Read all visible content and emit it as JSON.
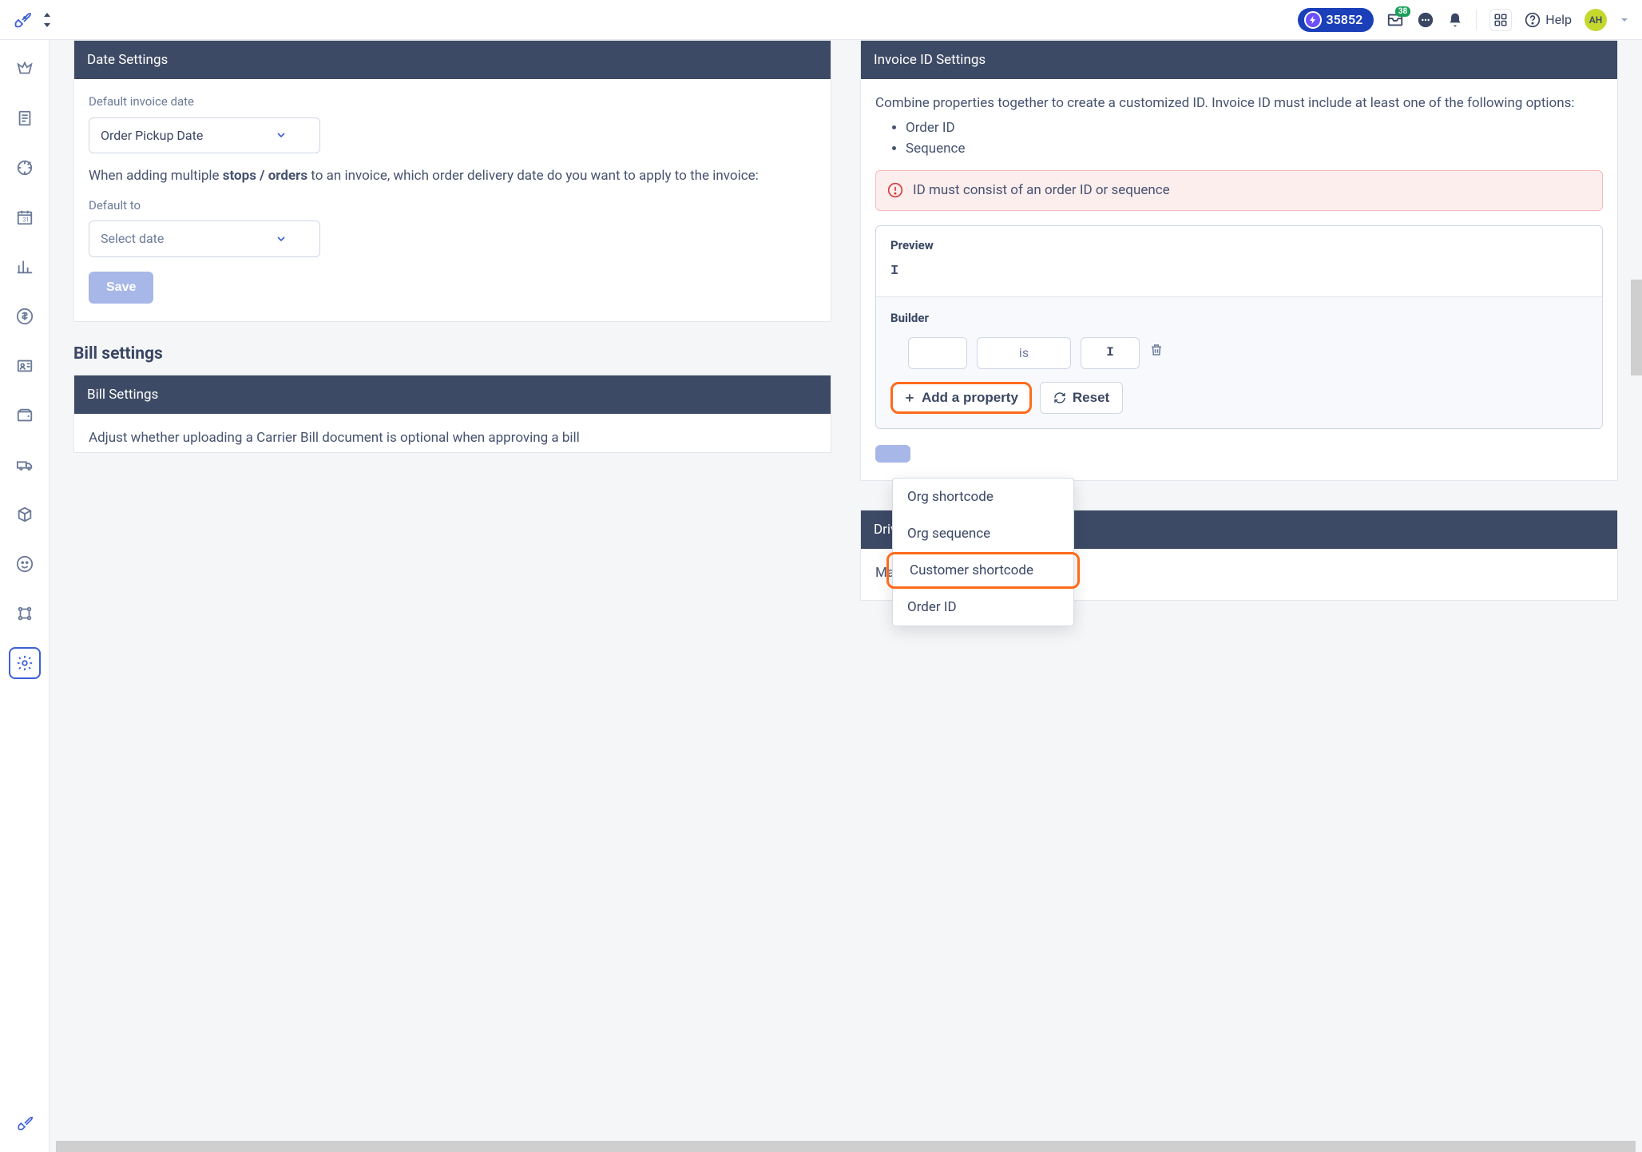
{
  "topbar": {
    "points": "35852",
    "notif_badge": "38",
    "help": "Help",
    "avatar": "AH"
  },
  "date_settings": {
    "header": "Date Settings",
    "default_label": "Default invoice date",
    "default_value": "Order Pickup Date",
    "multi_pre": "When adding multiple ",
    "multi_bold": "stops / orders",
    "multi_post": " to an invoice, which order delivery date do you want to apply to the invoice:",
    "default_to": "Default to",
    "select_placeholder": "Select date",
    "save": "Save"
  },
  "invoice_id": {
    "header": "Invoice ID Settings",
    "intro": "Combine properties together to create a customized ID. Invoice ID must include at least one of the following options:",
    "req1": "Order ID",
    "req2": "Sequence",
    "alert": "ID must consist of an order ID or sequence",
    "preview_label": "Preview",
    "preview_value": "I",
    "builder_label": "Builder",
    "slot_mid": "is",
    "slot_end": "I",
    "add_property": "Add a property",
    "reset": "Reset",
    "dropdown": {
      "opt1": "Org shortcode",
      "opt2": "Org sequence",
      "opt3": "Customer shortcode",
      "opt4": "Order ID"
    }
  },
  "bill": {
    "section": "Bill settings",
    "header": "Bill Settings",
    "text": "Adjust whether uploading a Carrier Bill document is optional when approving a bill"
  },
  "driver_pay": {
    "header": "Driver Pay Schedule",
    "text": "Manifest Grouping"
  }
}
